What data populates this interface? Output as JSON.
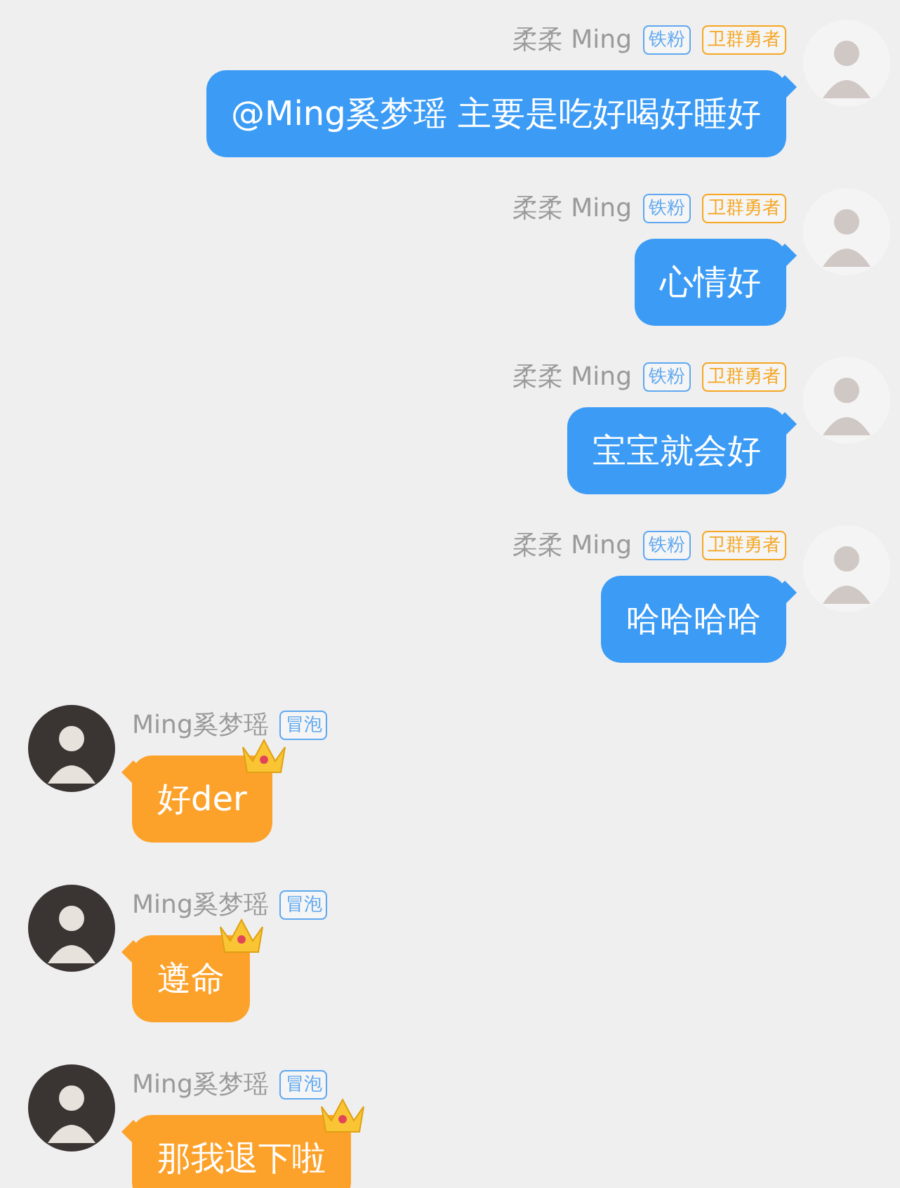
{
  "messages": [
    {
      "kind": "self",
      "sender": "柔柔 Ming",
      "badges": [
        {
          "label": "铁粉",
          "color": "#5fa8f0"
        },
        {
          "label": "卫群勇者",
          "color": "#f5a623"
        }
      ],
      "text": "@Ming奚梦瑶 主要是吃好喝好睡好"
    },
    {
      "kind": "self",
      "sender": "柔柔 Ming",
      "badges": [
        {
          "label": "铁粉",
          "color": "#5fa8f0"
        },
        {
          "label": "卫群勇者",
          "color": "#f5a623"
        }
      ],
      "text": "心情好"
    },
    {
      "kind": "self",
      "sender": "柔柔 Ming",
      "badges": [
        {
          "label": "铁粉",
          "color": "#5fa8f0"
        },
        {
          "label": "卫群勇者",
          "color": "#f5a623"
        }
      ],
      "text": "宝宝就会好"
    },
    {
      "kind": "self",
      "sender": "柔柔 Ming",
      "badges": [
        {
          "label": "铁粉",
          "color": "#5fa8f0"
        },
        {
          "label": "卫群勇者",
          "color": "#f5a623"
        }
      ],
      "text": "哈哈哈哈"
    },
    {
      "kind": "other",
      "sender": "Ming奚梦瑶",
      "badges": [
        {
          "label": "冒泡",
          "color": "#5fa8f0"
        }
      ],
      "text": "好der"
    },
    {
      "kind": "other",
      "sender": "Ming奚梦瑶",
      "badges": [
        {
          "label": "冒泡",
          "color": "#5fa8f0"
        }
      ],
      "text": "遵命"
    },
    {
      "kind": "other",
      "sender": "Ming奚梦瑶",
      "badges": [
        {
          "label": "冒泡",
          "color": "#5fa8f0"
        }
      ],
      "text": "那我退下啦"
    }
  ]
}
